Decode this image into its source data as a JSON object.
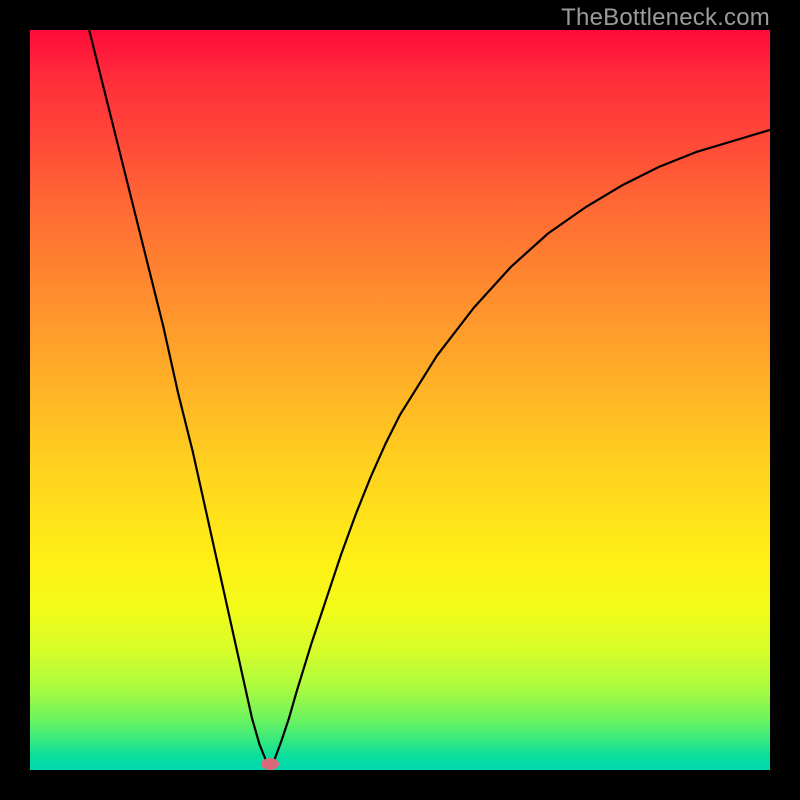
{
  "watermark": "TheBottleneck.com",
  "gradient_colors": {
    "top": "#ff0a3a",
    "mid_upper": "#ff8e2e",
    "mid": "#ffd41e",
    "mid_lower": "#d6fd2a",
    "bottom": "#00d8b0"
  },
  "marker": {
    "x_pct": 32.4,
    "y_pct": 99.2,
    "color": "#d96a7a"
  },
  "chart_data": {
    "type": "line",
    "title": "",
    "xlabel": "",
    "ylabel": "",
    "xlim": [
      0,
      100
    ],
    "ylim": [
      0,
      100
    ],
    "series": [
      {
        "name": "curve",
        "x": [
          8,
          10,
          12,
          14,
          16,
          18,
          20,
          22,
          24,
          26,
          28,
          30,
          31,
          32,
          32.4,
          33,
          34,
          35,
          36,
          38,
          40,
          42,
          44,
          46,
          48,
          50,
          55,
          60,
          65,
          70,
          75,
          80,
          85,
          90,
          95,
          100
        ],
        "y": [
          100,
          92,
          84,
          76,
          68,
          60,
          51,
          43,
          34,
          25,
          16,
          7,
          3.5,
          1,
          0,
          1.3,
          4,
          7,
          10.5,
          17,
          23,
          29,
          34.5,
          39.5,
          44,
          48,
          56,
          62.5,
          68,
          72.5,
          76,
          79,
          81.5,
          83.5,
          85,
          86.5
        ]
      }
    ],
    "annotations": [
      {
        "text": "TheBottleneck.com",
        "x": 96,
        "y": 102,
        "anchor": "top-right"
      }
    ]
  }
}
